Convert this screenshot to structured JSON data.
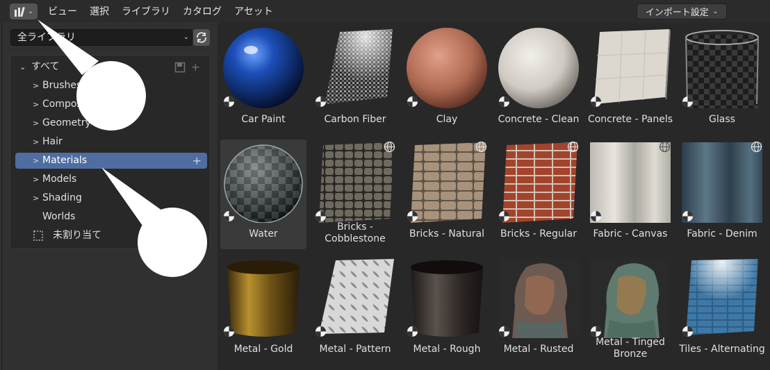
{
  "header": {
    "menu": [
      "ビュー",
      "選択",
      "ライブラリ",
      "カタログ",
      "アセット"
    ],
    "import_settings": "インポート設定"
  },
  "sidebar": {
    "library_select": "全ライブラリ",
    "root": "すべて",
    "catalogs": [
      "Brushes",
      "Compositing",
      "Geometry Nodes",
      "Hair",
      "Materials",
      "Models",
      "Shading",
      "Worlds"
    ],
    "unassigned": "未割り当て",
    "selected": "Materials"
  },
  "assets": [
    {
      "label": "Car Paint"
    },
    {
      "label": "Carbon Fiber"
    },
    {
      "label": "Clay"
    },
    {
      "label": "Concrete - Clean"
    },
    {
      "label": "Concrete - Panels"
    },
    {
      "label": "Glass"
    },
    {
      "label": "Water"
    },
    {
      "label": "Bricks - Cobblestone"
    },
    {
      "label": "Bricks - Natural"
    },
    {
      "label": "Bricks - Regular"
    },
    {
      "label": "Fabric - Canvas"
    },
    {
      "label": "Fabric - Denim"
    },
    {
      "label": "Metal - Gold"
    },
    {
      "label": "Metal - Pattern"
    },
    {
      "label": "Metal - Rough"
    },
    {
      "label": "Metal - Rusted"
    },
    {
      "label": "Metal - Tinged Bronze"
    },
    {
      "label": "Tiles - Alternating"
    }
  ],
  "colors": {
    "accent_selection": "#4f6da1",
    "panel_bg": "#282828",
    "header_bg": "#2b2b2b"
  },
  "icons": [
    "asset-browser-icon",
    "chevron-down-icon",
    "refresh-icon",
    "save-icon",
    "plus-icon",
    "chevron-right-icon",
    "unassigned-icon",
    "material-badge-icon",
    "globe-icon"
  ]
}
